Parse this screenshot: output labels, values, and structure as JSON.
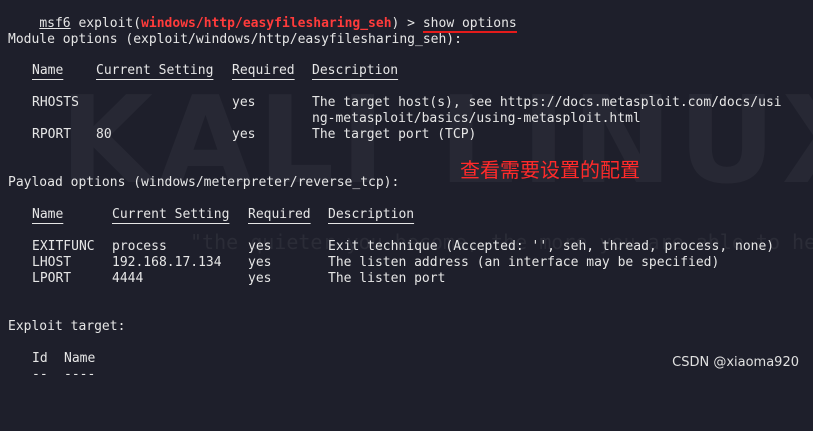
{
  "watermark": {
    "text": "KALI LINUX",
    "tagline": "\"the quieter you become, the more you are able to hear\""
  },
  "prompt": {
    "app": "msf6",
    "exploit_prefix": " exploit(",
    "module": "windows/http/easyfilesharing_seh",
    "exploit_suffix": ") > ",
    "command": "show options"
  },
  "module_options": {
    "title": "Module options (exploit/windows/http/easyfilesharing_seh):",
    "headers": {
      "name": "Name",
      "setting": "Current Setting",
      "required": "Required",
      "description": "Description"
    },
    "rows": [
      {
        "name": "RHOSTS",
        "setting": "",
        "required": "yes",
        "description": "The target host(s), see https://docs.metasploit.com/docs/usi",
        "description2": "ng-metasploit/basics/using-metasploit.html"
      },
      {
        "name": "RPORT",
        "setting": "80",
        "required": "yes",
        "description": "The target port (TCP)"
      }
    ]
  },
  "annotation": "查看需要设置的配置",
  "payload_options": {
    "title": "Payload options (windows/meterpreter/reverse_tcp):",
    "headers": {
      "name": "Name",
      "setting": "Current Setting",
      "required": "Required",
      "description": "Description"
    },
    "rows": [
      {
        "name": "EXITFUNC",
        "setting": "process",
        "required": "yes",
        "description": "Exit technique (Accepted: '', seh, thread, process, none)"
      },
      {
        "name": "LHOST",
        "setting": "192.168.17.134",
        "required": "yes",
        "description": "The listen address (an interface may be specified)"
      },
      {
        "name": "LPORT",
        "setting": "4444",
        "required": "yes",
        "description": "The listen port"
      }
    ]
  },
  "exploit_target": {
    "title": "Exploit target:",
    "headers": {
      "id": "Id",
      "name": "Name"
    },
    "dashes": {
      "id": "--",
      "name": "----"
    }
  },
  "credit": "CSDN @xiaoma920",
  "colors": {
    "background": "#1e1f2b",
    "module_name": "#ff3b3b",
    "underline_red": "#e51b1b",
    "annotation": "#ff2a2a"
  }
}
